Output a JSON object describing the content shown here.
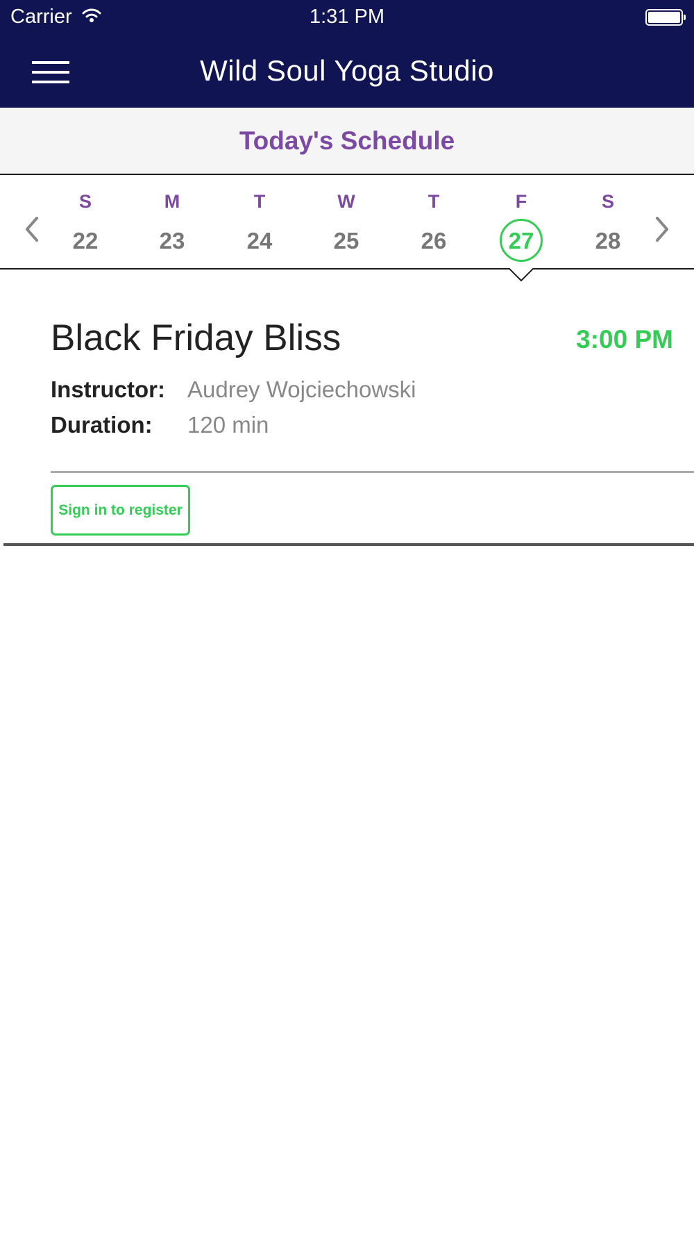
{
  "status_bar": {
    "carrier": "Carrier",
    "time": "1:31 PM",
    "battery_level": 1.0
  },
  "nav": {
    "title": "Wild Soul Yoga Studio",
    "menu_icon": "hamburger-menu-icon"
  },
  "schedule": {
    "heading": "Today's Schedule"
  },
  "week": {
    "days": [
      {
        "letter": "S",
        "number": "22"
      },
      {
        "letter": "M",
        "number": "23"
      },
      {
        "letter": "T",
        "number": "24"
      },
      {
        "letter": "W",
        "number": "25"
      },
      {
        "letter": "T",
        "number": "26"
      },
      {
        "letter": "F",
        "number": "27"
      },
      {
        "letter": "S",
        "number": "28"
      }
    ],
    "selected_index": 5,
    "prev_icon": "chevron-left-icon",
    "next_icon": "chevron-right-icon"
  },
  "class": {
    "title": "Black Friday Bliss",
    "time": "3:00 PM",
    "instructor_label": "Instructor:",
    "instructor": "Audrey Wojciechowski",
    "duration_label": "Duration:",
    "duration": "120 min",
    "register_label": "Sign in to register"
  },
  "colors": {
    "header_bg": "#101452",
    "accent_purple": "#7d4aa3",
    "accent_green": "#33cc55"
  }
}
